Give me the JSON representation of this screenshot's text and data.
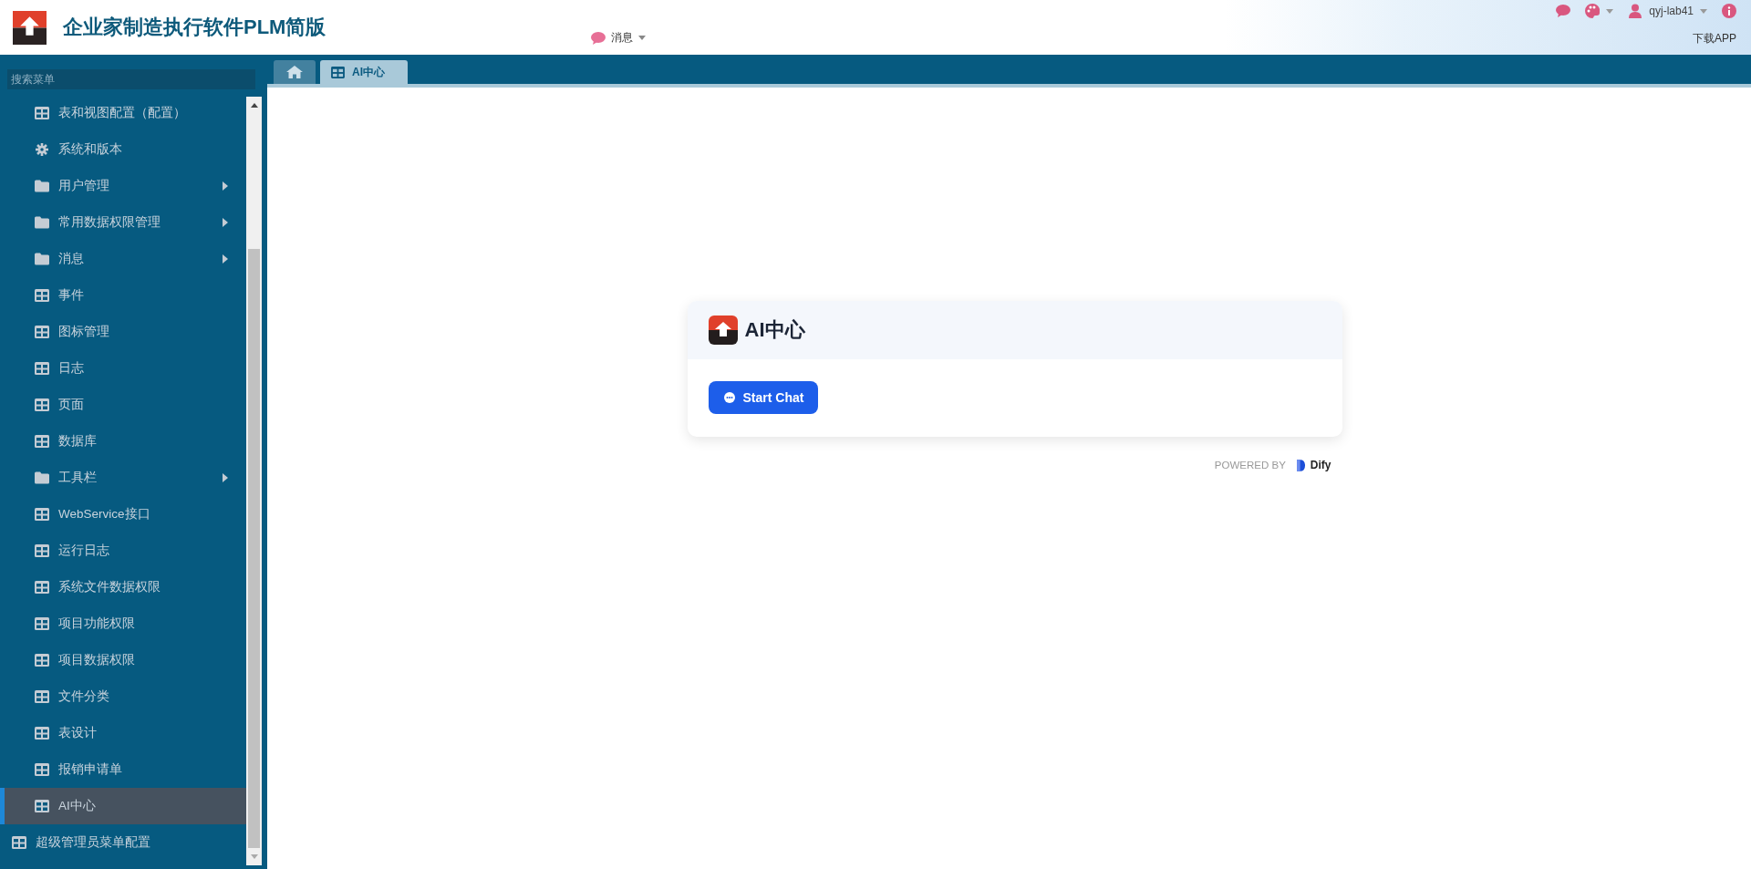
{
  "header": {
    "title": "企业家制造执行软件PLM简版",
    "messages_menu": "消息",
    "user": "qyj-lab41",
    "download": "下载APP"
  },
  "sidebar": {
    "search": {
      "placeholder": "搜索菜单"
    },
    "submenu_items": [
      {
        "label": "表和视图配置（配置）",
        "kind": "table",
        "expandable": false,
        "selected": false
      },
      {
        "label": "系统和版本",
        "kind": "gear",
        "expandable": false,
        "selected": false
      },
      {
        "label": "用户管理",
        "kind": "folder",
        "expandable": true,
        "selected": false
      },
      {
        "label": "常用数据权限管理",
        "kind": "folder",
        "expandable": true,
        "selected": false
      },
      {
        "label": "消息",
        "kind": "folder",
        "expandable": true,
        "selected": false
      },
      {
        "label": "事件",
        "kind": "table",
        "expandable": false,
        "selected": false
      },
      {
        "label": "图标管理",
        "kind": "table",
        "expandable": false,
        "selected": false
      },
      {
        "label": "日志",
        "kind": "table",
        "expandable": false,
        "selected": false
      },
      {
        "label": "页面",
        "kind": "table",
        "expandable": false,
        "selected": false
      },
      {
        "label": "数据库",
        "kind": "table",
        "expandable": false,
        "selected": false
      },
      {
        "label": "工具栏",
        "kind": "folder",
        "expandable": true,
        "selected": false
      },
      {
        "label": "WebService接口",
        "kind": "table",
        "expandable": false,
        "selected": false
      },
      {
        "label": "运行日志",
        "kind": "table",
        "expandable": false,
        "selected": false
      },
      {
        "label": "系统文件数据权限",
        "kind": "table",
        "expandable": false,
        "selected": false
      },
      {
        "label": "项目功能权限",
        "kind": "table",
        "expandable": false,
        "selected": false
      },
      {
        "label": "项目数据权限",
        "kind": "table",
        "expandable": false,
        "selected": false
      },
      {
        "label": "文件分类",
        "kind": "table",
        "expandable": false,
        "selected": false
      },
      {
        "label": "表设计",
        "kind": "table",
        "expandable": false,
        "selected": false
      },
      {
        "label": "报销申请单",
        "kind": "table",
        "expandable": false,
        "selected": false
      },
      {
        "label": "AI中心",
        "kind": "table",
        "expandable": false,
        "selected": true
      }
    ],
    "top_items": [
      {
        "label": "超级管理员菜单配置",
        "kind": "table",
        "expandable": false,
        "selected": false
      }
    ]
  },
  "tabs": [
    {
      "kind": "home",
      "selected": false
    },
    {
      "kind": "page",
      "label": "AI中心",
      "selected": true
    }
  ],
  "ai_card": {
    "title": "AI中心",
    "button": "Start Chat"
  },
  "powered_by": {
    "label": "POWERED BY",
    "brand": "Dify"
  }
}
